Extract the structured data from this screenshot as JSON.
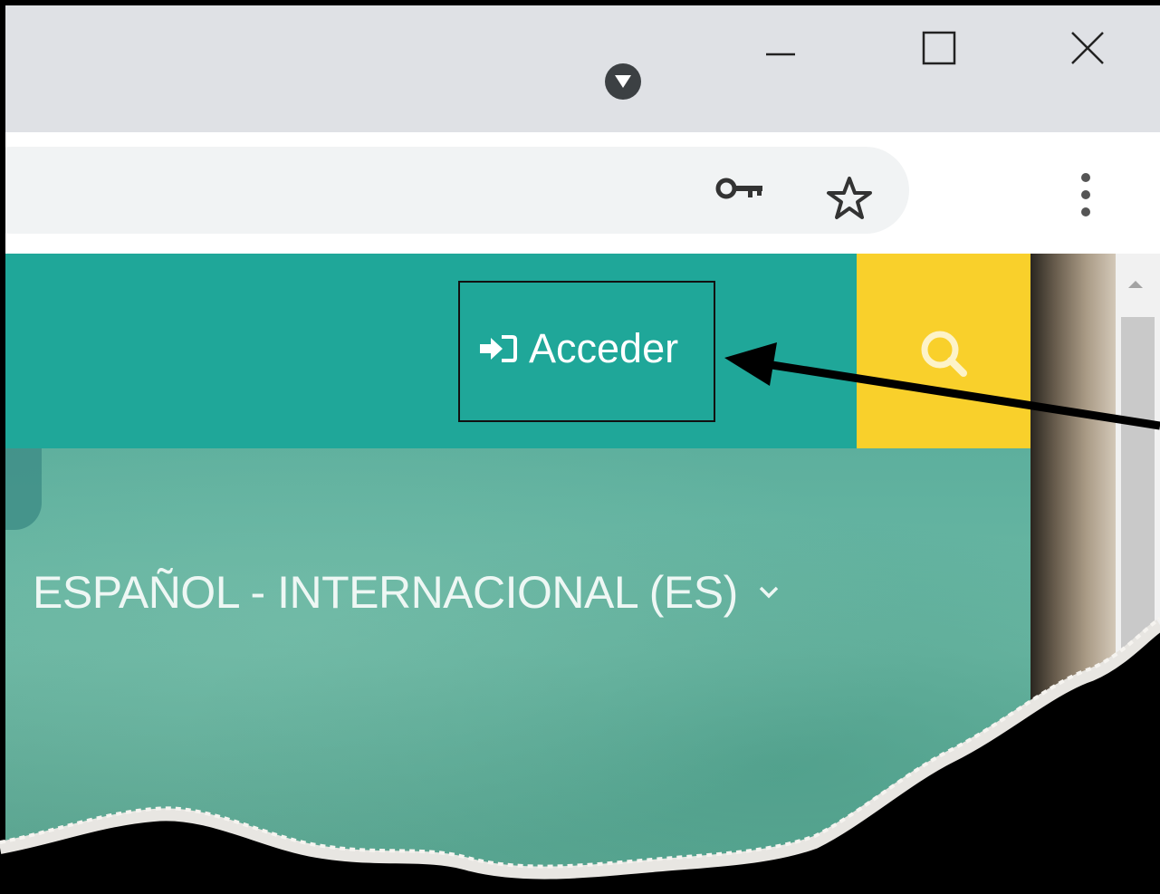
{
  "browser": {
    "window_controls": [
      "minimize",
      "maximize",
      "close"
    ],
    "toolbar_icons": [
      "key-icon",
      "star-icon",
      "menu-icon"
    ],
    "profile_icon": "profile-dropdown-icon"
  },
  "header": {
    "login_label": "Acceder",
    "login_icon": "sign-in-icon",
    "search_icon": "search-icon",
    "colors": {
      "header": "#1fa799",
      "search": "#f9d02b"
    }
  },
  "hero": {
    "language_label": "ESPAÑOL - INTERNACIONAL (ES)",
    "language_icon": "chevron-down-icon"
  }
}
